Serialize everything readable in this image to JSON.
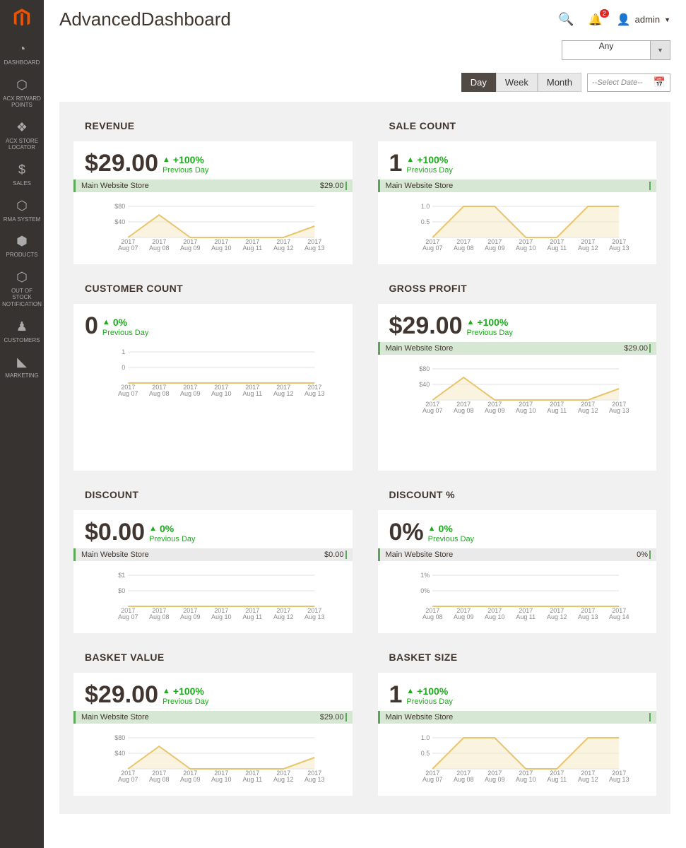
{
  "sidebar": {
    "items": [
      {
        "icon": "◔",
        "label": "DASHBOARD"
      },
      {
        "icon": "⬡",
        "label": "ACX REWARD POINTS"
      },
      {
        "icon": "❖",
        "label": "ACX STORE LOCATOR"
      },
      {
        "icon": "$",
        "label": "SALES"
      },
      {
        "icon": "⬡",
        "label": "RMA SYSTEM"
      },
      {
        "icon": "⬢",
        "label": "PRODUCTS"
      },
      {
        "icon": "⬡",
        "label": "OUT OF STOCK NOTIFICATION"
      },
      {
        "icon": "♟",
        "label": "CUSTOMERS"
      },
      {
        "icon": "◣",
        "label": "MARKETING"
      }
    ]
  },
  "header": {
    "title": "AdvancedDashboard",
    "notif_count": "2",
    "user": "admin"
  },
  "controls": {
    "store_value": "Any",
    "periods": [
      "Day",
      "Week",
      "Month"
    ],
    "active_period": "Day",
    "date_placeholder": "--Select Date--"
  },
  "cards": [
    {
      "title": "REVENUE",
      "value": "$29.00",
      "change": "+100%",
      "sub": "Previous Day",
      "store": "Main Website Store",
      "store_val": "$29.00",
      "store_bar_light": false
    },
    {
      "title": "SALE COUNT",
      "value": "1",
      "change": "+100%",
      "sub": "Previous Day",
      "store": "Main Website Store",
      "store_val": "",
      "store_bar_light": false
    },
    {
      "title": "CUSTOMER COUNT",
      "value": "0",
      "change": "0%",
      "sub": "Previous Day",
      "store": "",
      "store_val": "",
      "store_bar_light": false,
      "tall": true,
      "no_bar": true
    },
    {
      "title": "GROSS PROFIT",
      "value": "$29.00",
      "change": "+100%",
      "sub": "Previous Day",
      "store": "Main Website Store",
      "store_val": "$29.00",
      "store_bar_light": false,
      "tall": true
    },
    {
      "title": "DISCOUNT",
      "value": "$0.00",
      "change": "0%",
      "sub": "Previous Day",
      "store": "Main Website Store",
      "store_val": "$0.00",
      "store_bar_light": true
    },
    {
      "title": "DISCOUNT %",
      "value": "0%",
      "change": "0%",
      "sub": "Previous Day",
      "store": "Main Website Store",
      "store_val": "0%",
      "store_bar_light": true
    },
    {
      "title": "BASKET VALUE",
      "value": "$29.00",
      "change": "+100%",
      "sub": "Previous Day",
      "store": "Main Website Store",
      "store_val": "$29.00",
      "store_bar_light": false
    },
    {
      "title": "BASKET SIZE",
      "value": "1",
      "change": "+100%",
      "sub": "Previous Day",
      "store": "Main Website Store",
      "store_val": "",
      "store_bar_light": false
    }
  ],
  "chart_data": [
    {
      "type": "line",
      "title": "REVENUE",
      "ylabel": "",
      "ylim": [
        0,
        80
      ],
      "yticks": [
        "$40",
        "$80"
      ],
      "categories": [
        "Aug 07, 2017",
        "Aug 08, 2017",
        "Aug 09, 2017",
        "Aug 10, 2017",
        "Aug 11, 2017",
        "Aug 12, 2017",
        "Aug 13, 2017"
      ],
      "values": [
        0,
        58,
        0,
        0,
        0,
        0,
        29
      ]
    },
    {
      "type": "line",
      "title": "SALE COUNT",
      "ylabel": "",
      "ylim": [
        0,
        1
      ],
      "yticks": [
        "0.5",
        "1.0"
      ],
      "categories": [
        "Aug 07, 2017",
        "Aug 08, 2017",
        "Aug 09, 2017",
        "Aug 10, 2017",
        "Aug 11, 2017",
        "Aug 12, 2017",
        "Aug 13, 2017"
      ],
      "values": [
        0,
        1,
        1,
        0,
        0,
        1,
        1
      ]
    },
    {
      "type": "line",
      "title": "CUSTOMER COUNT",
      "ylabel": "",
      "ylim": [
        0,
        1
      ],
      "yticks": [
        "0",
        "1"
      ],
      "categories": [
        "Aug 07, 2017",
        "Aug 08, 2017",
        "Aug 09, 2017",
        "Aug 10, 2017",
        "Aug 11, 2017",
        "Aug 12, 2017",
        "Aug 13, 2017"
      ],
      "values": [
        0,
        0,
        0,
        0,
        0,
        0,
        0
      ]
    },
    {
      "type": "line",
      "title": "GROSS PROFIT",
      "ylabel": "",
      "ylim": [
        0,
        80
      ],
      "yticks": [
        "$40",
        "$80"
      ],
      "categories": [
        "Aug 07, 2017",
        "Aug 08, 2017",
        "Aug 09, 2017",
        "Aug 10, 2017",
        "Aug 11, 2017",
        "Aug 12, 2017",
        "Aug 13, 2017"
      ],
      "values": [
        0,
        58,
        0,
        0,
        0,
        0,
        29
      ]
    },
    {
      "type": "line",
      "title": "DISCOUNT",
      "ylabel": "",
      "ylim": [
        0,
        1
      ],
      "yticks": [
        "$0",
        "$1"
      ],
      "categories": [
        "Aug 07, 2017",
        "Aug 08, 2017",
        "Aug 09, 2017",
        "Aug 10, 2017",
        "Aug 11, 2017",
        "Aug 12, 2017",
        "Aug 13, 2017"
      ],
      "values": [
        0,
        0,
        0,
        0,
        0,
        0,
        0
      ]
    },
    {
      "type": "line",
      "title": "DISCOUNT %",
      "ylabel": "",
      "ylim": [
        0,
        1
      ],
      "yticks": [
        "0%",
        "1%"
      ],
      "categories": [
        "Aug 08, 2017",
        "Aug 09, 2017",
        "Aug 10, 2017",
        "Aug 11, 2017",
        "Aug 12, 2017",
        "Aug 13, 2017",
        "Aug 14, 2017"
      ],
      "values": [
        0,
        0,
        0,
        0,
        0,
        0,
        0
      ]
    },
    {
      "type": "line",
      "title": "BASKET VALUE",
      "ylabel": "",
      "ylim": [
        0,
        80
      ],
      "yticks": [
        "$40",
        "$80"
      ],
      "categories": [
        "Aug 07, 2017",
        "Aug 08, 2017",
        "Aug 09, 2017",
        "Aug 10, 2017",
        "Aug 11, 2017",
        "Aug 12, 2017",
        "Aug 13, 2017"
      ],
      "values": [
        0,
        58,
        0,
        0,
        0,
        0,
        29
      ]
    },
    {
      "type": "line",
      "title": "BASKET SIZE",
      "ylabel": "",
      "ylim": [
        0,
        1
      ],
      "yticks": [
        "0.5",
        "1.0"
      ],
      "categories": [
        "Aug 07, 2017",
        "Aug 08, 2017",
        "Aug 09, 2017",
        "Aug 10, 2017",
        "Aug 11, 2017",
        "Aug 12, 2017",
        "Aug 13, 2017"
      ],
      "values": [
        0,
        1,
        1,
        0,
        0,
        1,
        1
      ]
    }
  ]
}
